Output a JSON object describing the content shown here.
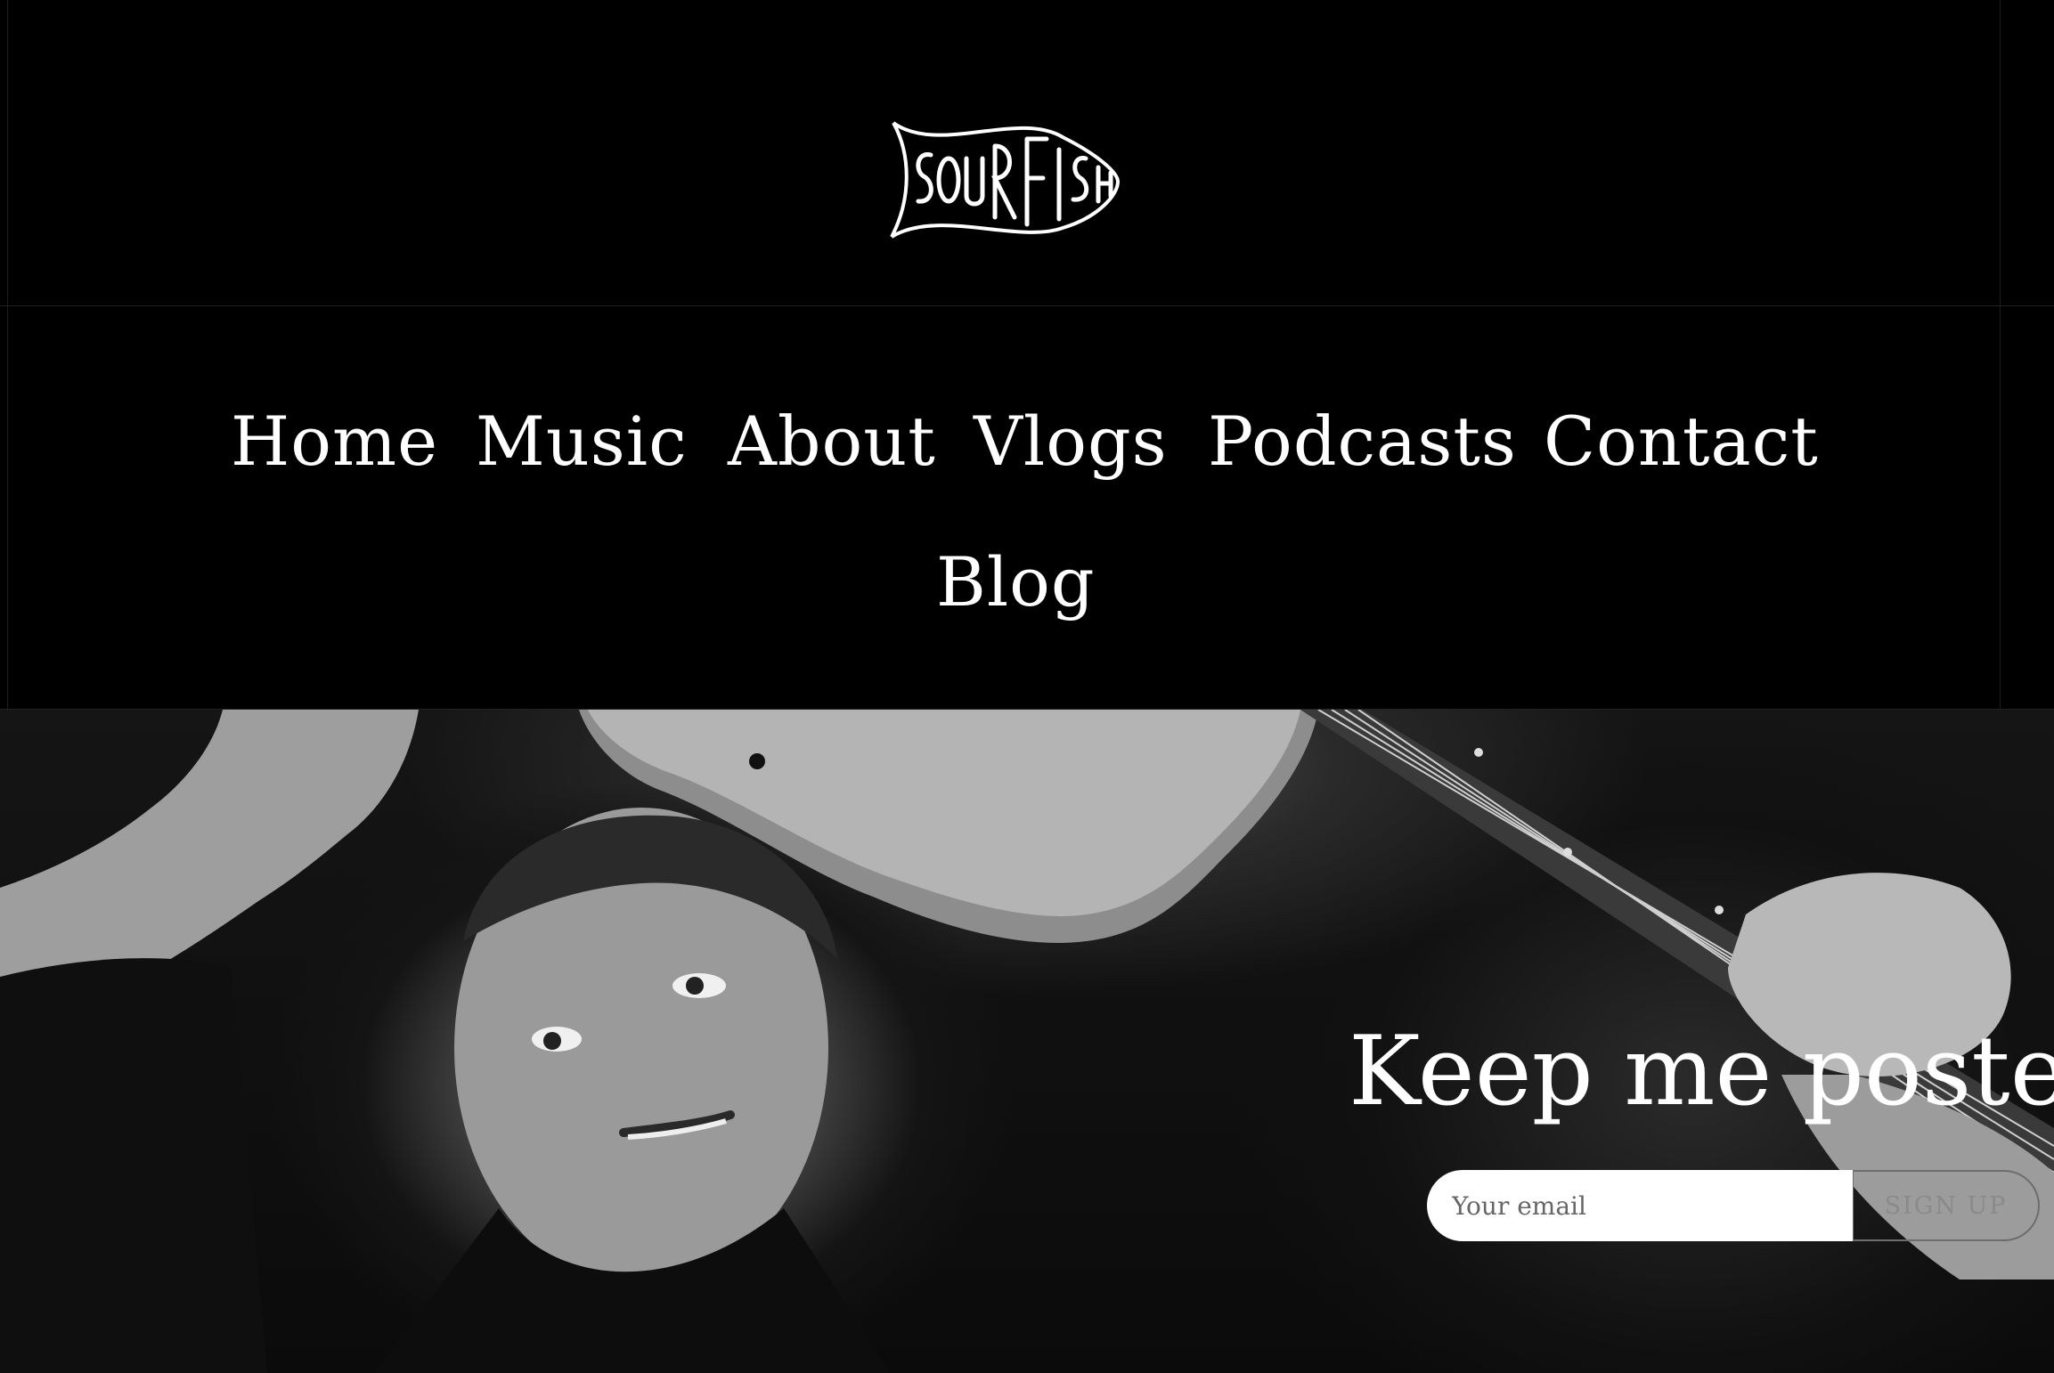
{
  "brand": {
    "logo_text": "SOURFISH",
    "logo_icon": "fish-logo-icon"
  },
  "nav": {
    "items": [
      {
        "label": "Home"
      },
      {
        "label": "Music"
      },
      {
        "label": "About"
      },
      {
        "label": "Vlogs"
      },
      {
        "label": "Podcasts"
      },
      {
        "label": "Contact"
      },
      {
        "label": "Blog"
      }
    ]
  },
  "hero": {
    "image": "musician-with-guitar-photo",
    "signup": {
      "title": "Keep me posted",
      "email_placeholder": "Your email",
      "button_label": "SIGN UP"
    }
  },
  "colors": {
    "background": "#000000",
    "text": "#ffffff",
    "button_border": "#6d6d6d"
  }
}
